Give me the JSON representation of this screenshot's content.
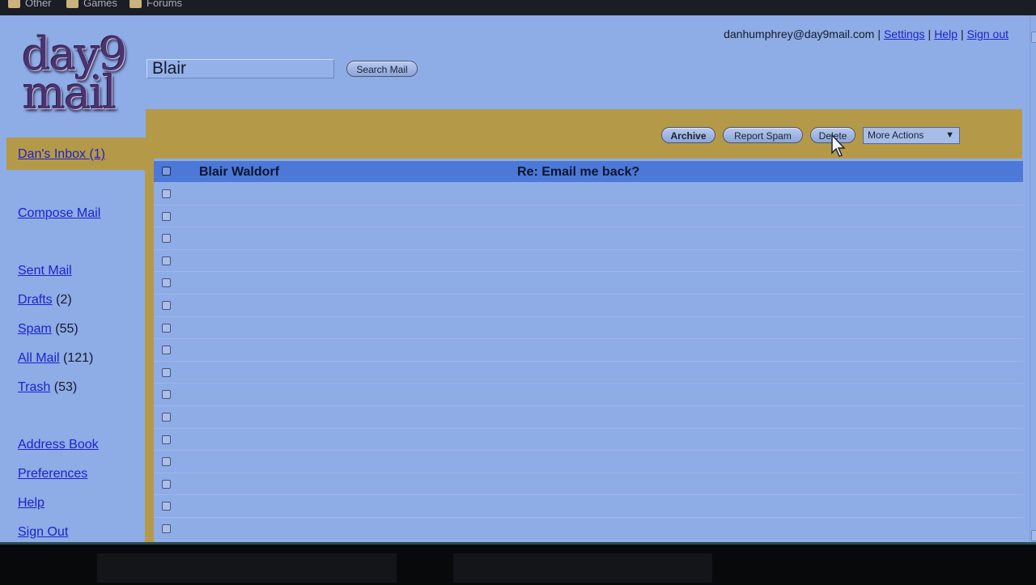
{
  "bookmarks": [
    "Other",
    "Games",
    "Forums"
  ],
  "logo": {
    "line1": "day9",
    "line2": "mail"
  },
  "search": {
    "value": "Blair",
    "button": "Search Mail"
  },
  "user": {
    "email": "danhumphrey@day9mail.com",
    "settings": "Settings",
    "help": "Help",
    "signout": "Sign out",
    "separator": "|"
  },
  "toolbar": {
    "archive": "Archive",
    "report_spam": "Report Spam",
    "delete": "Delete",
    "more_actions": "More Actions",
    "more_actions_arrow": "▼"
  },
  "sidebar": {
    "inbox": "Dan's Inbox (1)",
    "compose": "Compose Mail",
    "sent": "Sent Mail",
    "drafts": {
      "label": "Drafts",
      "count": "(2)"
    },
    "spam": {
      "label": "Spam",
      "count": "(55)"
    },
    "all_mail": {
      "label": "All Mail",
      "count": "(121)"
    },
    "trash": {
      "label": "Trash",
      "count": "(53)"
    },
    "address_book": "Address Book",
    "preferences": "Preferences",
    "help": "Help",
    "sign_out": "Sign Out"
  },
  "messages": [
    {
      "sender": "Blair Waldorf",
      "subject": "Re: Email me back?"
    }
  ],
  "colors": {
    "page_bg": "#8eace6",
    "gold": "#b49a48",
    "header_row": "#4c78d8",
    "link": "#1d22c9"
  }
}
